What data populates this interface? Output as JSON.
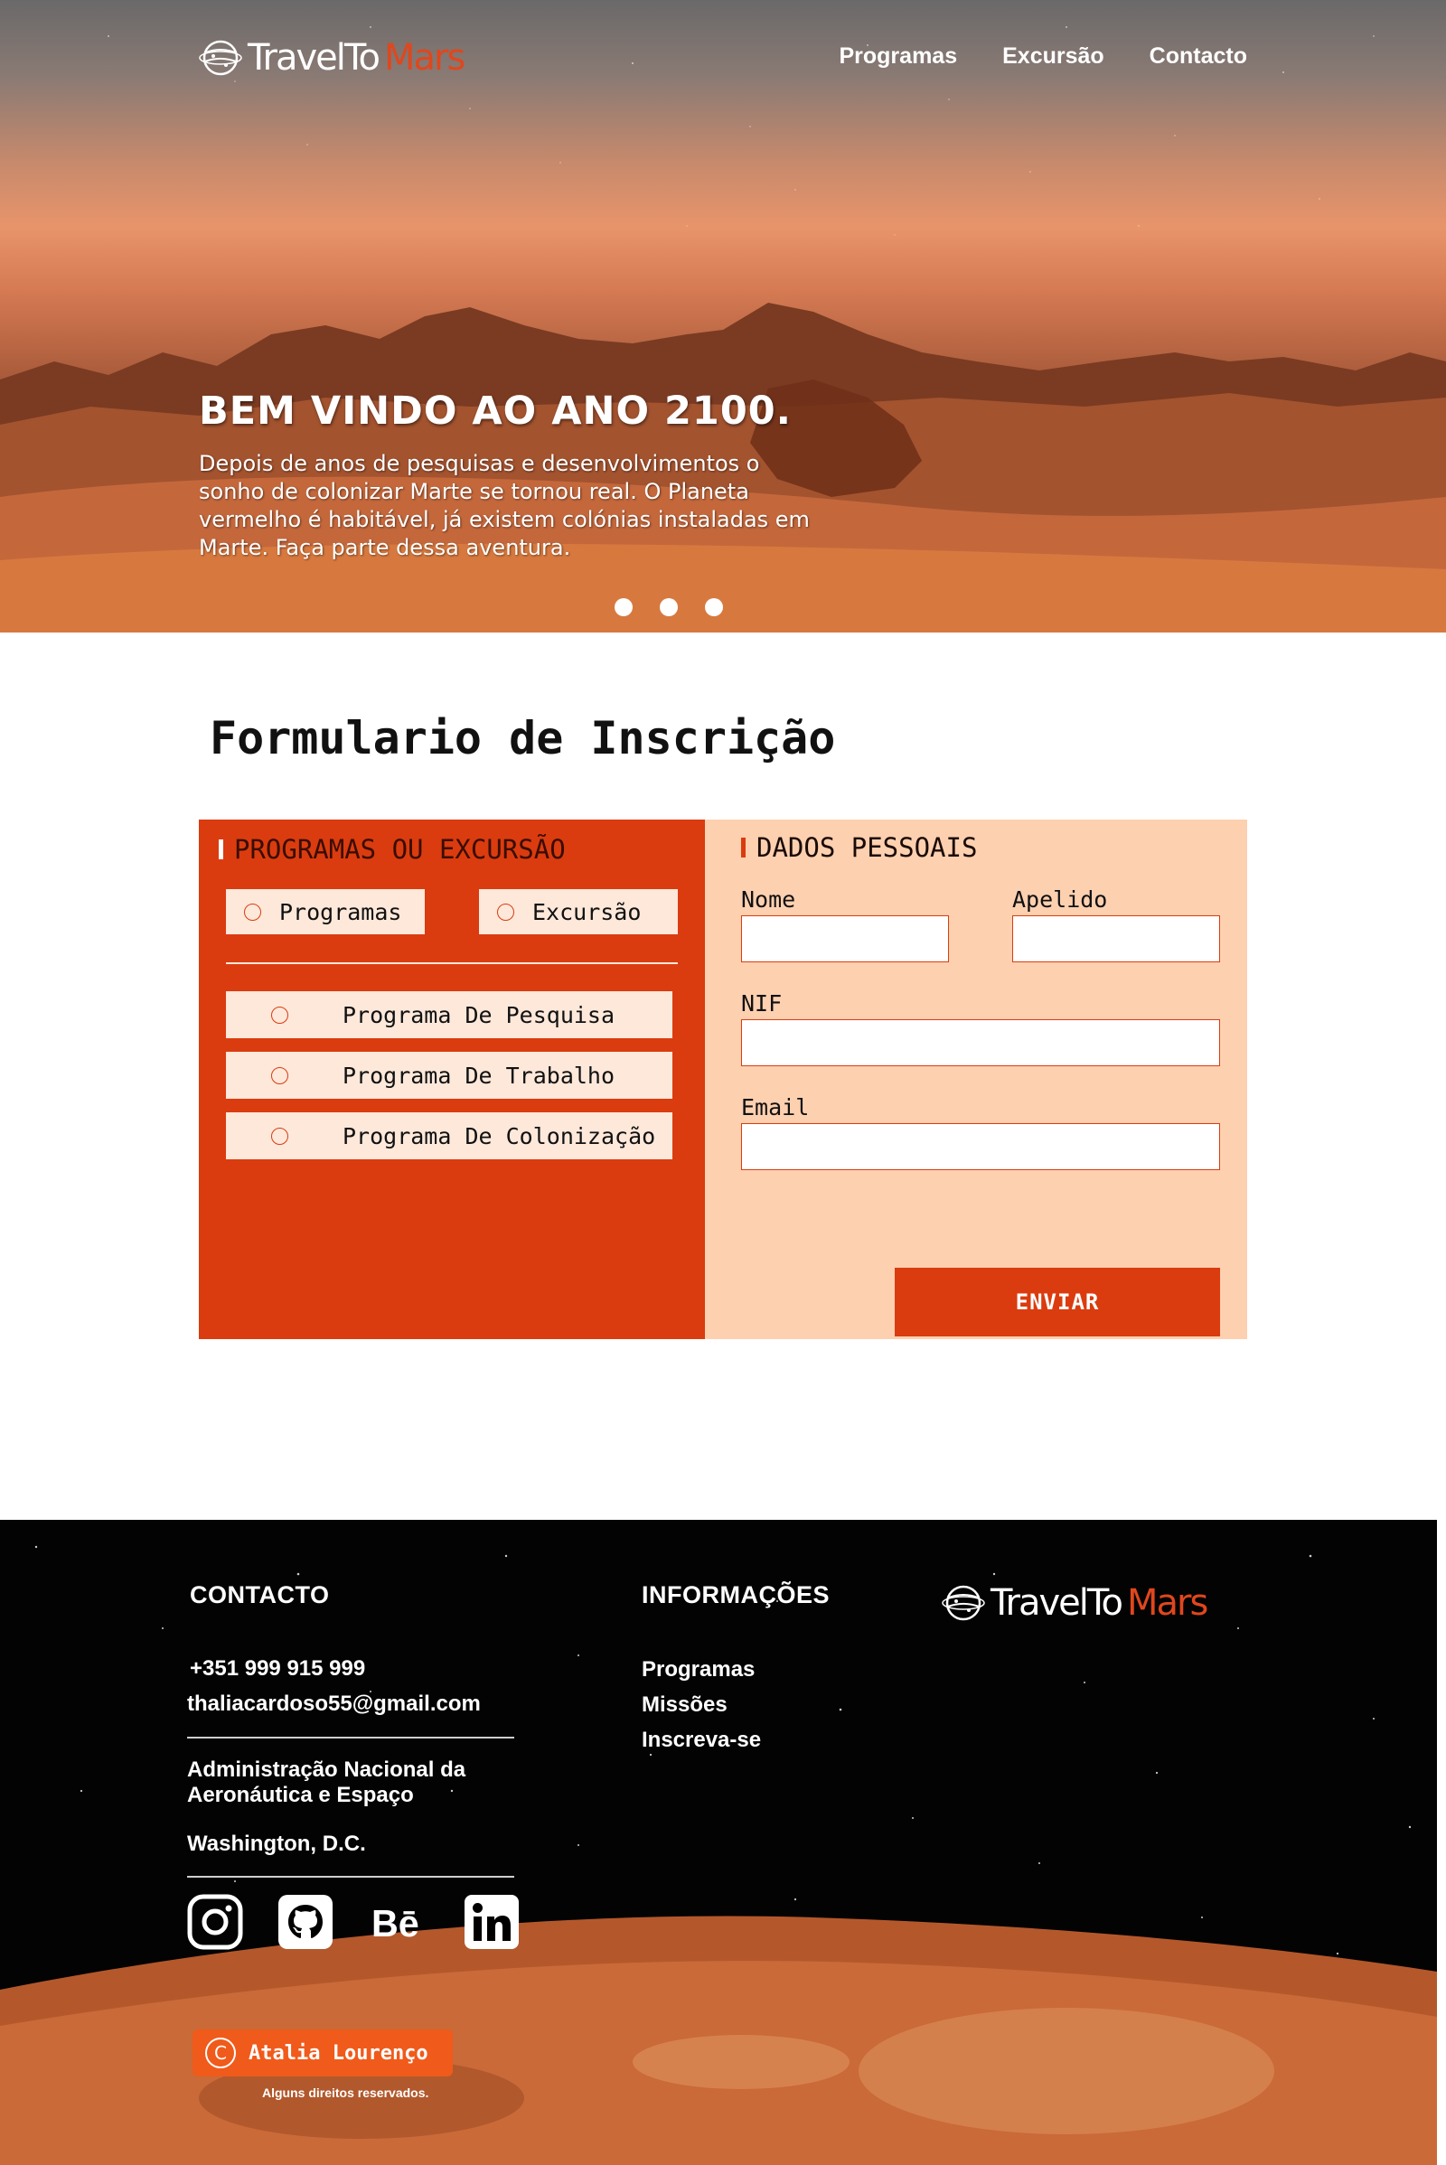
{
  "header": {
    "brand": {
      "part1": "TravelTo",
      "part2": "Mars"
    },
    "nav": [
      {
        "label": "Programas"
      },
      {
        "label": "Excursão"
      },
      {
        "label": "Contacto"
      }
    ]
  },
  "hero": {
    "title": "BEM VINDO AO ANO 2100.",
    "text": "Depois de anos de pesquisas e desenvolvimentos o sonho de colonizar Marte se tornou real. O Planeta vermelho é habitável, já existem colónias instaladas em Marte. Faça parte dessa aventura.",
    "slides": 3
  },
  "form": {
    "title": "Formulario de Inscrição",
    "left": {
      "heading": "PROGRAMAS OU EXCURSÃO",
      "types": [
        {
          "label": "Programas"
        },
        {
          "label": "Excursão"
        }
      ],
      "programs": [
        {
          "label": "Programa De Pesquisa"
        },
        {
          "label": "Programa De Trabalho"
        },
        {
          "label": "Programa De Colonização"
        }
      ]
    },
    "right": {
      "heading": "DADOS PESSOAIS",
      "fields": {
        "nome": {
          "label": "Nome",
          "value": ""
        },
        "apelido": {
          "label": "Apelido",
          "value": ""
        },
        "nif": {
          "label": "NIF",
          "value": ""
        },
        "email": {
          "label": "Email",
          "value": ""
        }
      },
      "submit": "ENVIAR"
    },
    "colors": {
      "accent": "#da3c0f",
      "panel": "#fdd0b0",
      "option_bg": "#fde8da"
    }
  },
  "footer": {
    "contact": {
      "heading": "CONTACTO",
      "phone": "+351 999 915 999",
      "email": "thaliacardoso55@gmail.com",
      "org_line1": "Administração Nacional da",
      "org_line2": "Aeronáutica e Espaço",
      "city": "Washington, D.C."
    },
    "info": {
      "heading": "INFORMAÇÕES",
      "links": [
        {
          "label": "Programas"
        },
        {
          "label": "Missões"
        },
        {
          "label": "Inscreva-se"
        }
      ]
    },
    "brand": {
      "part1": "TravelTo",
      "part2": "Mars"
    },
    "social": [
      {
        "icon": "instagram-icon"
      },
      {
        "icon": "github-icon"
      },
      {
        "icon": "behance-icon"
      },
      {
        "icon": "linkedin-icon"
      }
    ],
    "copyright": {
      "symbol": "C",
      "name": "Atalia Lourenço",
      "rights": "Alguns direitos reservados."
    }
  }
}
